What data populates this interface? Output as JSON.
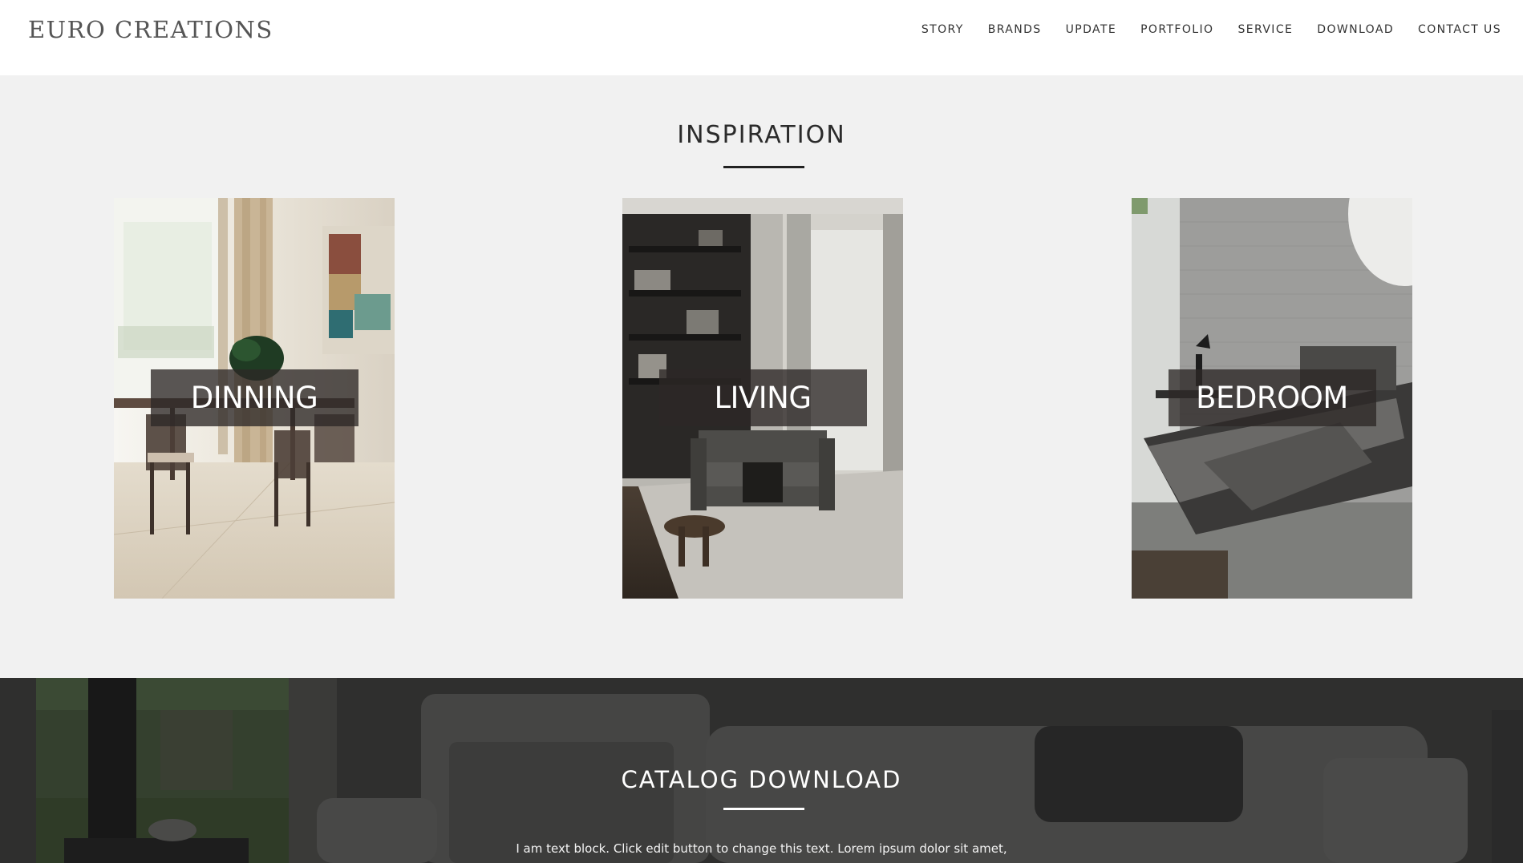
{
  "header": {
    "logo": "EURO CREATIONS",
    "nav": [
      "STORY",
      "BRANDS",
      "UPDATE",
      "PORTFOLIO",
      "SERVICE",
      "DOWNLOAD",
      "CONTACT US"
    ]
  },
  "inspiration": {
    "title": "INSPIRATION",
    "cards": [
      {
        "label": "DINNING"
      },
      {
        "label": "LIVING"
      },
      {
        "label": "BEDROOM"
      }
    ]
  },
  "catalog": {
    "title": "CATALOG DOWNLOAD",
    "text": "I am text block. Click edit button to change this text. Lorem ipsum dolor sit amet,"
  },
  "colors": {
    "background": "#f1f1f1",
    "header": "#ffffff",
    "label_overlay": "#2d2826",
    "catalog_band": "#2a2a2a"
  }
}
